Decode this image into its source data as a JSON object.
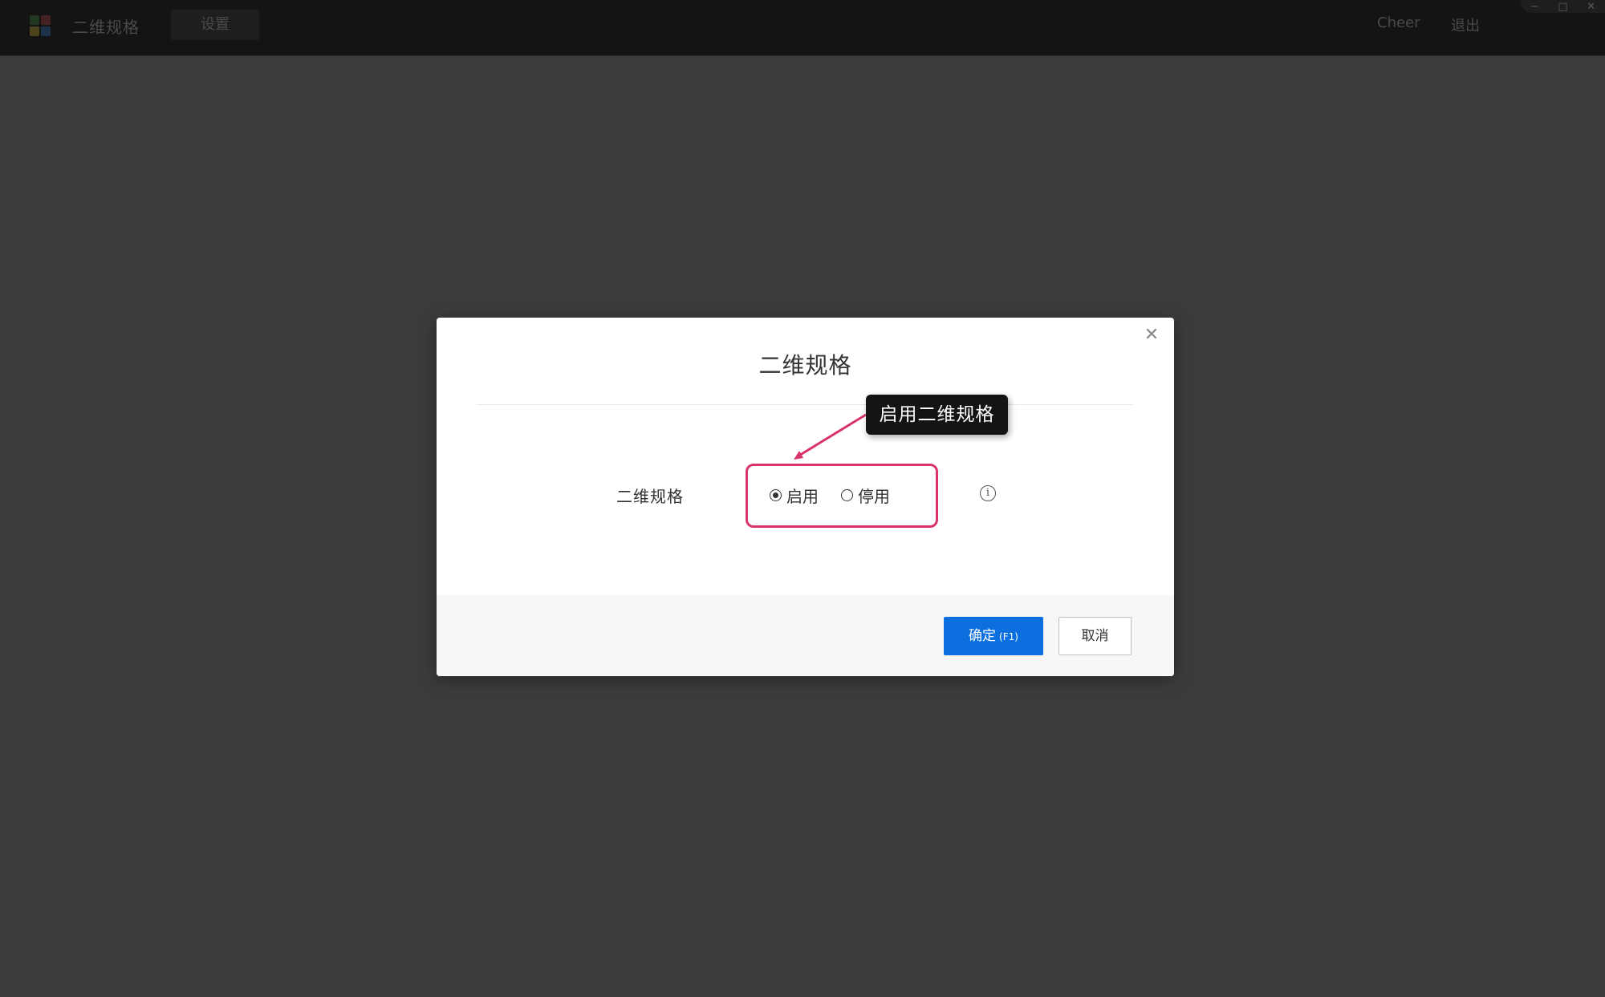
{
  "app": {
    "title": "二维规格",
    "tab": "设置",
    "user": "Cheer",
    "logout": "退出",
    "window_controls": [
      "−",
      "□",
      "✕"
    ]
  },
  "dialog": {
    "title": "二维规格",
    "close_icon": "close-icon",
    "field_label": "二维规格",
    "options": [
      {
        "label": "启用",
        "checked": true
      },
      {
        "label": "停用",
        "checked": false
      }
    ],
    "info_icon": "info-icon",
    "ok_label": "确定",
    "ok_shortcut": "(F1)",
    "cancel_label": "取消"
  },
  "annotation": {
    "callout": "启用二维规格",
    "color": "#d8336f"
  },
  "colors": {
    "primary": "#0c6fe0",
    "annotation": "#d8336f",
    "backdrop": "#3b3b3b"
  }
}
